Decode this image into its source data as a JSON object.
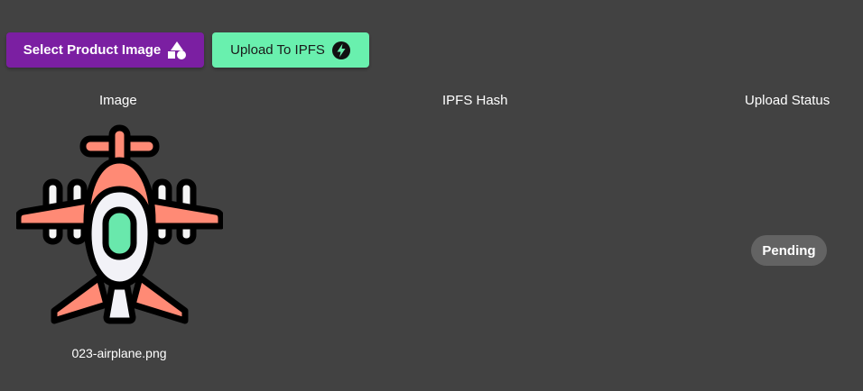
{
  "toolbar": {
    "select_label": "Select Product Image",
    "select_icon": "shapes-icon",
    "upload_label": "Upload To IPFS",
    "upload_icon": "bolt-icon"
  },
  "table": {
    "headers": {
      "image": "Image",
      "hash": "IPFS Hash",
      "status": "Upload Status"
    },
    "rows": [
      {
        "image_icon": "airplane-icon",
        "file_name": "023-airplane.png",
        "ipfs_hash": "",
        "status": "Pending"
      }
    ]
  },
  "colors": {
    "background": "#424242",
    "select_button": "#7b1fa2",
    "upload_button": "#69f0ae",
    "badge": "#636363"
  }
}
